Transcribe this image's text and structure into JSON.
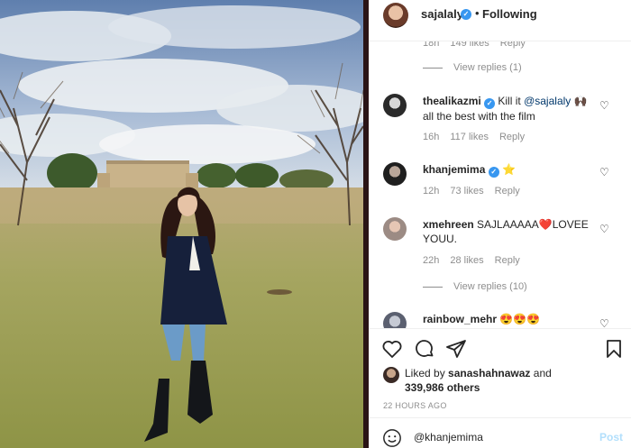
{
  "header": {
    "username": "sajalaly",
    "follow_status": "Following",
    "separator": "•"
  },
  "partial_comment": {
    "age": "18h",
    "likes": "149 likes",
    "reply": "Reply"
  },
  "view_replies_1": "View replies (1)",
  "comments": [
    {
      "username": "thealikazmi",
      "text_before": "Kill it",
      "mention": "@sajalaly",
      "emoji": "🙌🏿",
      "text_after": "all the best with the film",
      "age": "16h",
      "likes": "117 likes",
      "reply": "Reply"
    },
    {
      "username": "khanjemima",
      "text": "⭐",
      "age": "12h",
      "likes": "73 likes",
      "reply": "Reply"
    },
    {
      "username": "xmehreen",
      "text": "SAJLAAAAA❤️LOVEE YOUU.",
      "age": "22h",
      "likes": "28 likes",
      "reply": "Reply"
    },
    {
      "username": "rainbow_mehr",
      "text": "😍😍😍"
    }
  ],
  "view_replies_10": "View replies (10)",
  "actions": {
    "liked_by_prefix": "Liked by",
    "liked_by_user": "sanashahnawaz",
    "liked_by_and": "and",
    "others": "339,986 others",
    "time_ago": "22 HOURS AGO"
  },
  "comment_box": {
    "value": "@khanjemima",
    "post_label": "Post"
  },
  "colors": {
    "link": "#00376b",
    "verified": "#3897f0",
    "muted": "#8e8e8e",
    "post_disabled": "#b2dffc"
  },
  "icons": [
    "verified-icon",
    "heart-icon",
    "comment-icon",
    "share-icon",
    "bookmark-icon",
    "emoji-icon"
  ]
}
